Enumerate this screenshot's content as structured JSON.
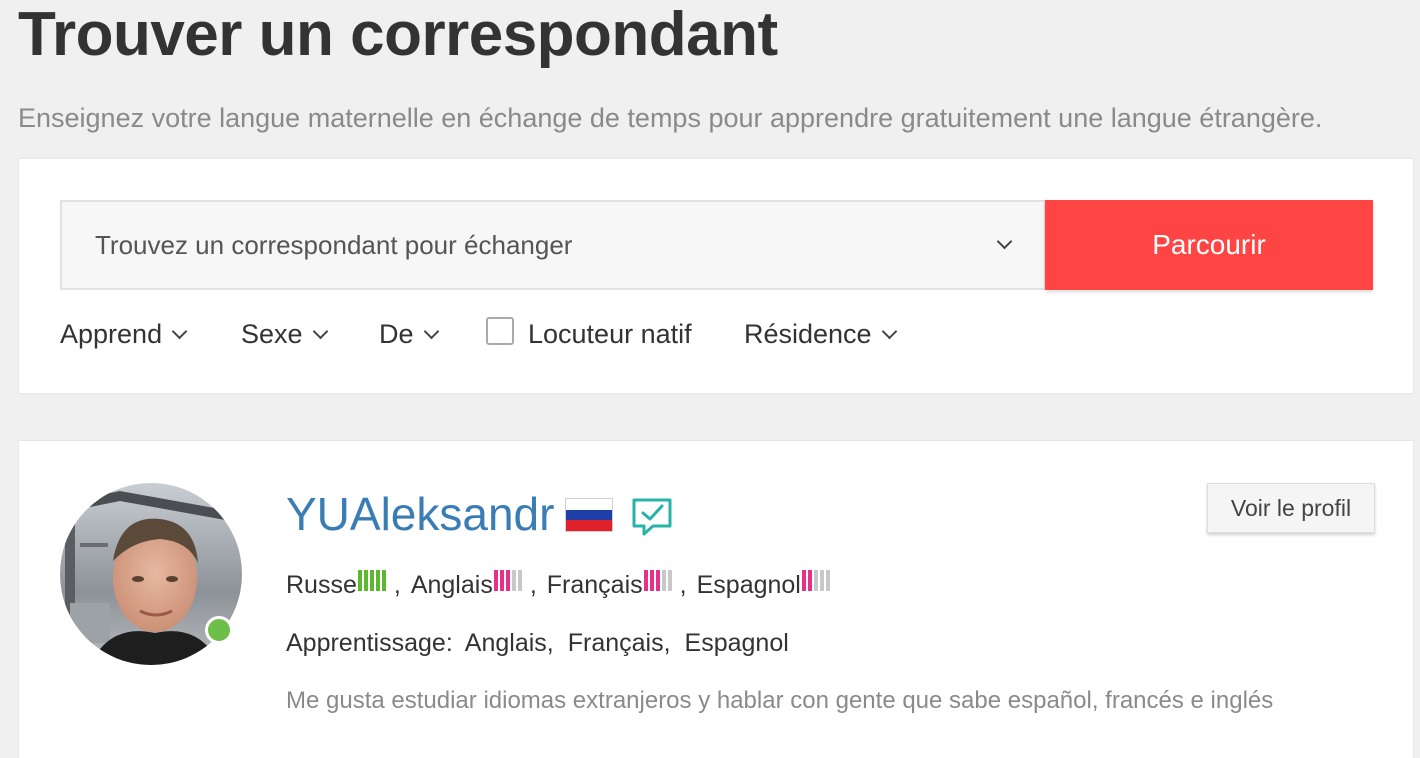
{
  "page": {
    "title": "Trouver un correspondant",
    "subtitle": "Enseignez votre langue maternelle en échange de temps pour apprendre gratuitement une langue étrangère."
  },
  "search": {
    "select_value": "Trouvez un correspondant pour échanger",
    "browse_label": "Parcourir",
    "accent_color": "#ff4444"
  },
  "filters": {
    "learns": "Apprend",
    "sex": "Sexe",
    "from": "De",
    "native_speaker": "Locuteur natif",
    "native_speaker_checked": false,
    "residence": "Résidence"
  },
  "profile": {
    "username": "YUAleksandr",
    "flag_icon": "russia-flag-icon",
    "online": true,
    "view_profile_label": "Voir le profil",
    "languages": [
      {
        "name": "Russe",
        "level": 5,
        "level_color": "#5cb82e"
      },
      {
        "name": "Anglais",
        "level": 3,
        "level_color": "#e8308a"
      },
      {
        "name": "Français",
        "level": 3,
        "level_color": "#e8308a"
      },
      {
        "name": "Espagnol",
        "level": 2,
        "level_color": "#e8308a"
      }
    ],
    "language_separator": ",",
    "learning_label": "Apprentissage:",
    "learning": [
      "Anglais,",
      "Français,",
      "Espagnol"
    ],
    "bio": "Me gusta estudiar idiomas extranjeros y hablar con gente que sabe español, francés e inglés"
  }
}
